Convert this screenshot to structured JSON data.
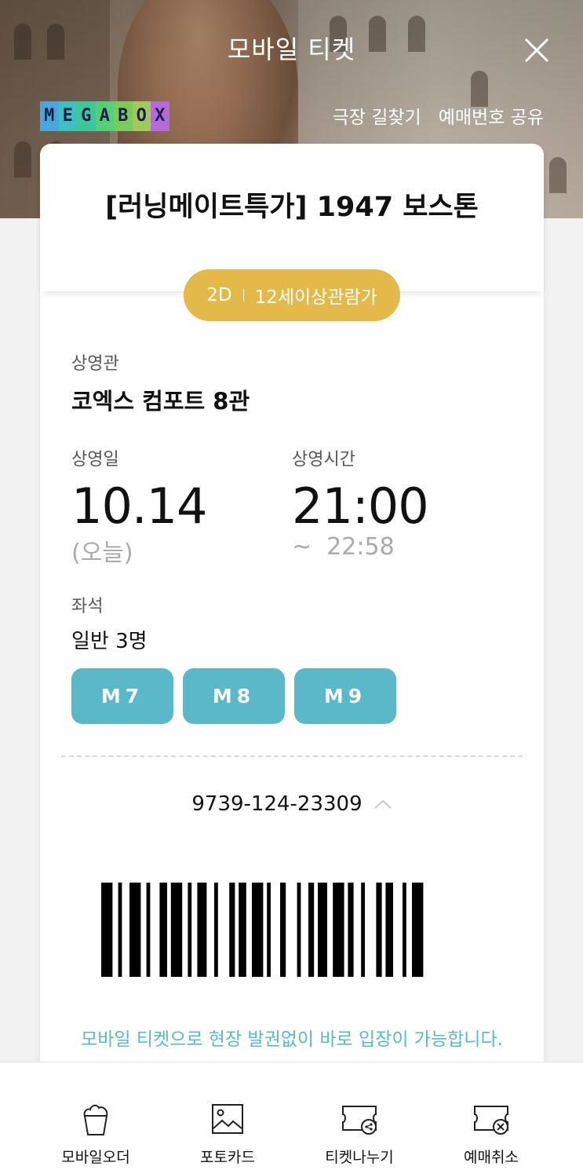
{
  "header": {
    "title": "모바일 티켓",
    "close_icon": "close-icon",
    "logo_letters": [
      "M",
      "E",
      "G",
      "A",
      "B",
      "O",
      "X"
    ],
    "logo_colors": [
      "#4aa8d8",
      "#3cc0c0",
      "#3cc89a",
      "#54d07a",
      "#7acb5c",
      "#a0c85a",
      "#b46ad8"
    ],
    "links": {
      "directions": "극장 길찾기",
      "share": "예매번호 공유"
    }
  },
  "ticket": {
    "movie_title": "[러닝메이트특가] 1947 보스톤",
    "format": "2D",
    "rating": "12세이상관람가",
    "rating_color": "#e3b94a",
    "theater_label": "상영관",
    "theater": "코엑스 컴포트 8관",
    "date_label": "상영일",
    "date": "10.14",
    "date_note": "(오늘)",
    "time_label": "상영시간",
    "start_time": "21:00",
    "end_time": "~  22:58",
    "seat_label": "좌석",
    "seat_summary": "일반 3명",
    "seats": [
      "M7",
      "M8",
      "M9"
    ],
    "seat_color": "#5ab8c9",
    "booking_number": "9739-124-23309",
    "notice": "모바일 티켓으로 현장 발권없이 바로 입장이 가능합니다."
  },
  "bottom_nav": [
    {
      "label": "모바일오더",
      "icon": "popcorn-icon"
    },
    {
      "label": "포토카드",
      "icon": "photo-icon"
    },
    {
      "label": "티켓나누기",
      "icon": "ticket-share-icon"
    },
    {
      "label": "예매취소",
      "icon": "ticket-cancel-icon"
    }
  ]
}
